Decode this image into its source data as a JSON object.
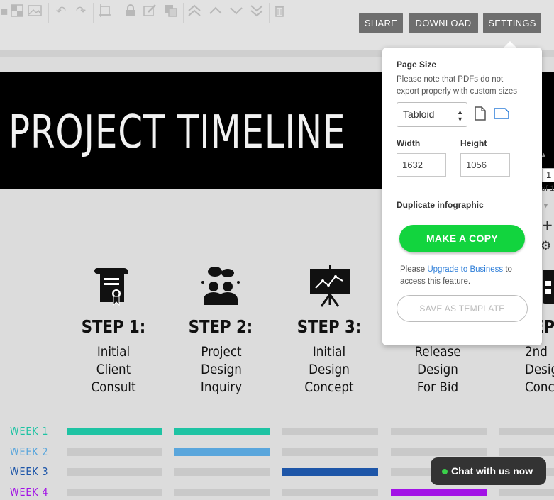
{
  "toolbar": {
    "icons": [
      "checkerboard-icon",
      "image-icon",
      "undo-icon",
      "redo-icon",
      "crop-icon",
      "lock-icon",
      "edit-icon",
      "duplicate-icon",
      "bring-to-front-icon",
      "move-up-icon",
      "move-down-icon",
      "send-to-back-icon",
      "trash-icon"
    ],
    "share_label": "SHARE",
    "download_label": "DOWNLOAD",
    "settings_label": "SETTINGS"
  },
  "infographic": {
    "title": "PROJECT TIMELINE",
    "steps": [
      {
        "title": "STEP 1:",
        "desc": [
          "Initial",
          "Client",
          "Consult"
        ],
        "icon": "certificate-icon"
      },
      {
        "title": "STEP 2:",
        "desc": [
          "Project",
          "Design",
          "Inquiry"
        ],
        "icon": "people-discussion-icon"
      },
      {
        "title": "STEP 3:",
        "desc": [
          "Initial",
          "Design",
          "Concept"
        ],
        "icon": "presentation-board-icon"
      },
      {
        "title": "",
        "desc": [
          "Release",
          "Design",
          "For Bid"
        ],
        "icon": ""
      },
      {
        "title": "EP",
        "desc": [
          "2nd",
          "Desig",
          "Conce"
        ],
        "icon": "calendar-icon"
      }
    ],
    "weeks": [
      {
        "label": "WEEK 1",
        "color": "#1ec3a3",
        "active": [
          0,
          1
        ]
      },
      {
        "label": "WEEK 2",
        "color": "#5aa6dc",
        "active": [
          1
        ]
      },
      {
        "label": "WEEK 3",
        "color": "#1e56a8",
        "active": [
          2
        ]
      },
      {
        "label": "WEEK 4",
        "color": "#a212e6",
        "active": [
          3
        ]
      }
    ],
    "bar_grey": "#c9c9c9"
  },
  "edge_tools": {
    "page_number": "1",
    "page_of": "of 1"
  },
  "settings": {
    "page_size_heading": "Page Size",
    "page_size_note": [
      "Please note that PDFs do not",
      "export properly with custom sizes"
    ],
    "size_selected": "Tabloid",
    "width_label": "Width",
    "height_label": "Height",
    "width_value": "1632",
    "height_value": "1056",
    "duplicate_heading": "Duplicate infographic",
    "copy_label": "MAKE A COPY",
    "upgrade_prefix": "Please ",
    "upgrade_link": "Upgrade to Business",
    "upgrade_suffix": " to access this feature.",
    "template_label": "SAVE AS TEMPLATE",
    "accent": "#12d43e",
    "link_color": "#2f7fd9"
  },
  "chat": {
    "label": "Chat with us now"
  }
}
